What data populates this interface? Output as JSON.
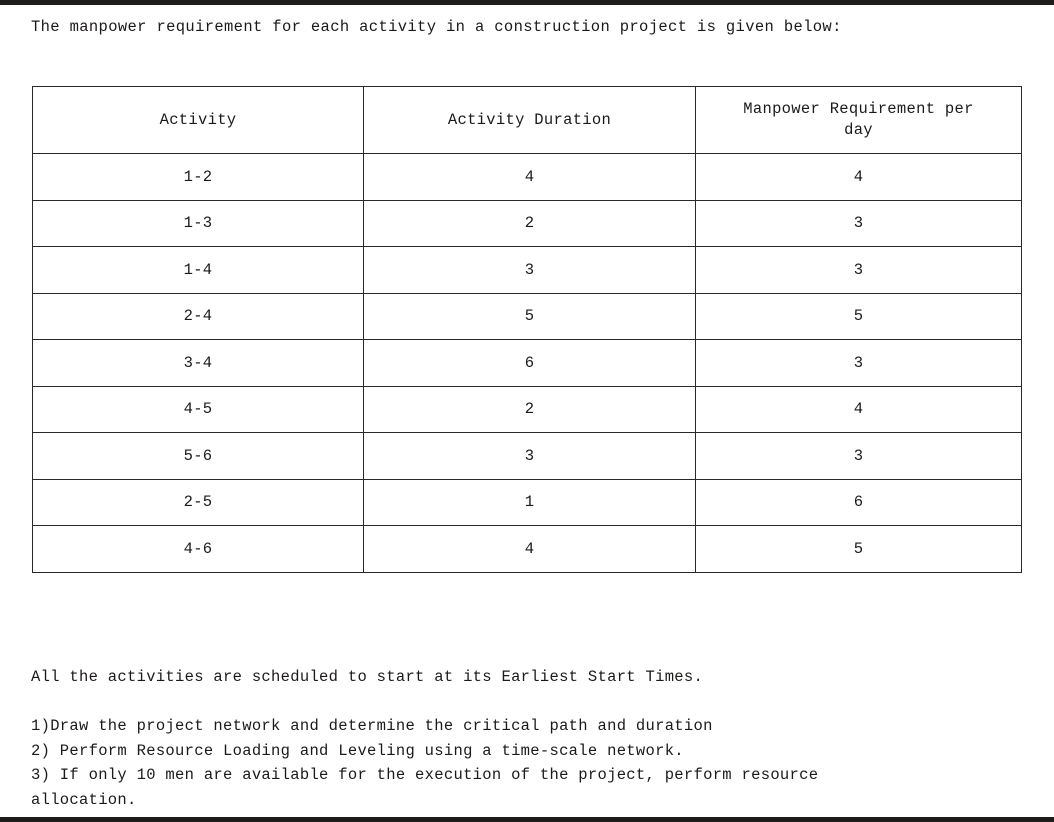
{
  "page": {
    "intro_text": "The manpower requirement for each activity in a construction project is given below:"
  },
  "table": {
    "headers": {
      "activity": "Activity",
      "duration": "Activity Duration",
      "manpower_line1": "Manpower Requirement per",
      "manpower_line2": "day"
    },
    "rows": [
      {
        "activity": "1-2",
        "duration": "4",
        "manpower": "4"
      },
      {
        "activity": "1-3",
        "duration": "2",
        "manpower": "3"
      },
      {
        "activity": "1-4",
        "duration": "3",
        "manpower": "3"
      },
      {
        "activity": "2-4",
        "duration": "5",
        "manpower": "5"
      },
      {
        "activity": "3-4",
        "duration": "6",
        "manpower": "3"
      },
      {
        "activity": "4-5",
        "duration": "2",
        "manpower": "4"
      },
      {
        "activity": "5-6",
        "duration": "3",
        "manpower": "3"
      },
      {
        "activity": "2-5",
        "duration": "1",
        "manpower": "6"
      },
      {
        "activity": "4-6",
        "duration": "4",
        "manpower": "5"
      }
    ]
  },
  "notes": {
    "lead": "All the activities are scheduled to start at its Earliest Start Times.",
    "items": [
      "1)Draw the project network and determine the critical path and duration",
      "2) Perform Resource Loading and Leveling using a time-scale network.",
      "3) If only 10 men are available for the execution of the project, perform resource",
      "allocation."
    ]
  },
  "colors": {
    "edge_bar": "#1e1c1b",
    "text": "#1c1a19",
    "border": "#2b2926",
    "background": "#ffffff"
  }
}
